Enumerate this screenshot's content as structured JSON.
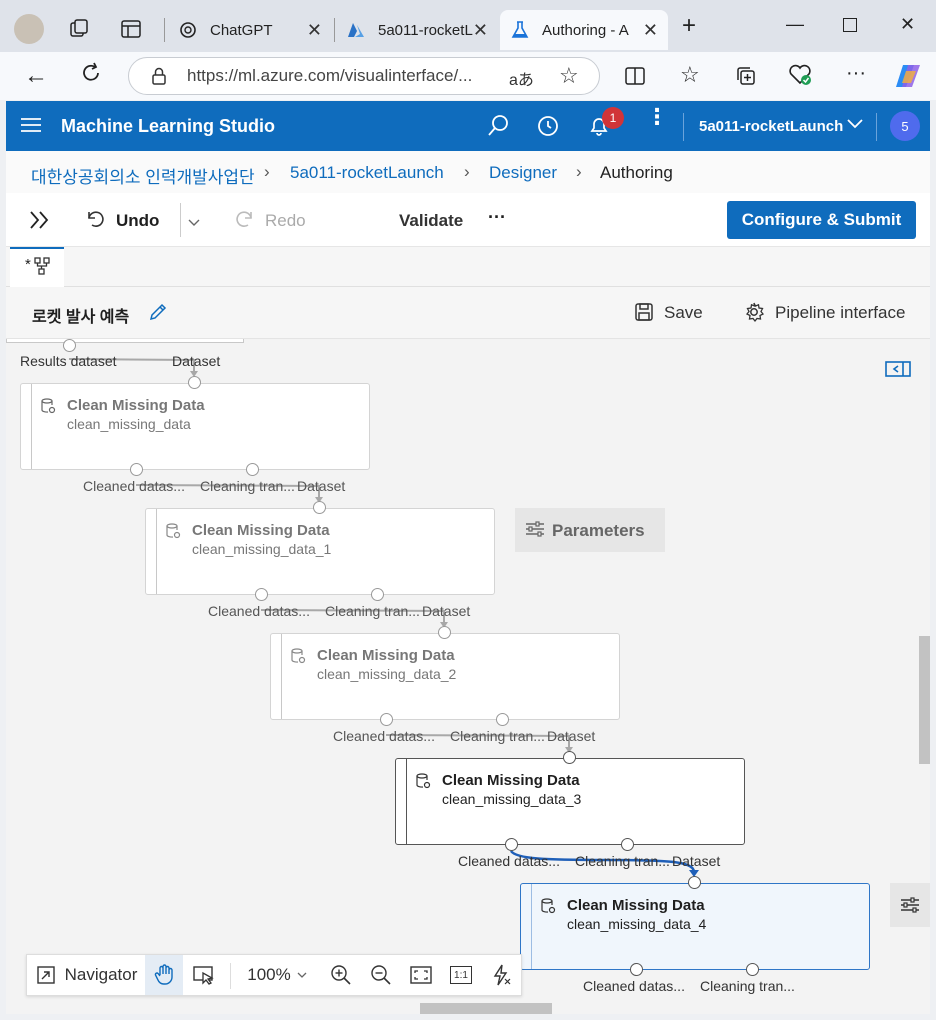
{
  "browser": {
    "tabs": [
      {
        "label": "ChatGPT"
      },
      {
        "label": "5a011-rocketL"
      },
      {
        "label": "Authoring - A"
      }
    ],
    "url": "https://ml.azure.com/visualinterface/..."
  },
  "app": {
    "title": "Machine Learning Studio",
    "notification_count": "1",
    "workspace": "5a011-rocketLaunch",
    "avatar": "5"
  },
  "breadcrumb": [
    "대한상공회의소 인력개발사업단",
    "5a011-rocketLaunch",
    "Designer",
    "Authoring"
  ],
  "toolbar": {
    "undo": "Undo",
    "redo": "Redo",
    "validate": "Validate",
    "more": "···",
    "submit": "Configure & Submit"
  },
  "pipeline": {
    "tab_marker": "*",
    "name": "로켓 발사 예측",
    "save": "Save",
    "interface": "Pipeline interface"
  },
  "canvas": {
    "top_labels": {
      "results": "Results dataset",
      "dataset": "Dataset"
    },
    "parameters": "Parameters",
    "node_title": "Clean Missing Data",
    "nodes": [
      {
        "title": "Clean Missing Data",
        "sub": "clean_missing_data"
      },
      {
        "title": "Clean Missing Data",
        "sub": "clean_missing_data_1"
      },
      {
        "title": "Clean Missing Data",
        "sub": "clean_missing_data_2"
      },
      {
        "title": "Clean Missing Data",
        "sub": "clean_missing_data_3"
      },
      {
        "title": "Clean Missing Data",
        "sub": "clean_missing_data_4"
      }
    ],
    "port_labels": {
      "cleaned": "Cleaned datas...",
      "transform": "Cleaning tran...",
      "dataset": "Dataset"
    }
  },
  "navigator": {
    "label": "Navigator",
    "zoom": "100%",
    "ratio": "1:1"
  },
  "colors": {
    "accent": "#0f6cbd",
    "badge": "#d13438"
  }
}
